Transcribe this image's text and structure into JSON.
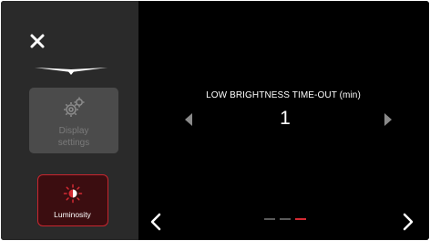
{
  "sidebar": {
    "display_settings_label": "Display\nsettings",
    "luminosity_label": "Luminosity"
  },
  "setting": {
    "title": "LOW BRIGHTNESS TIME-OUT (min)",
    "value": "1"
  },
  "pager": {
    "pages": 3,
    "active_index": 2
  },
  "colors": {
    "accent": "#d42a33",
    "sidebar_bg": "#2a2a2a",
    "tile_bg": "#4b4b4b",
    "main_bg": "#000000"
  },
  "icons": {
    "close": "close-icon",
    "display": "gear-icon",
    "luminosity": "brightness-icon",
    "prev": "chevron-left-icon",
    "next": "chevron-right-icon"
  }
}
